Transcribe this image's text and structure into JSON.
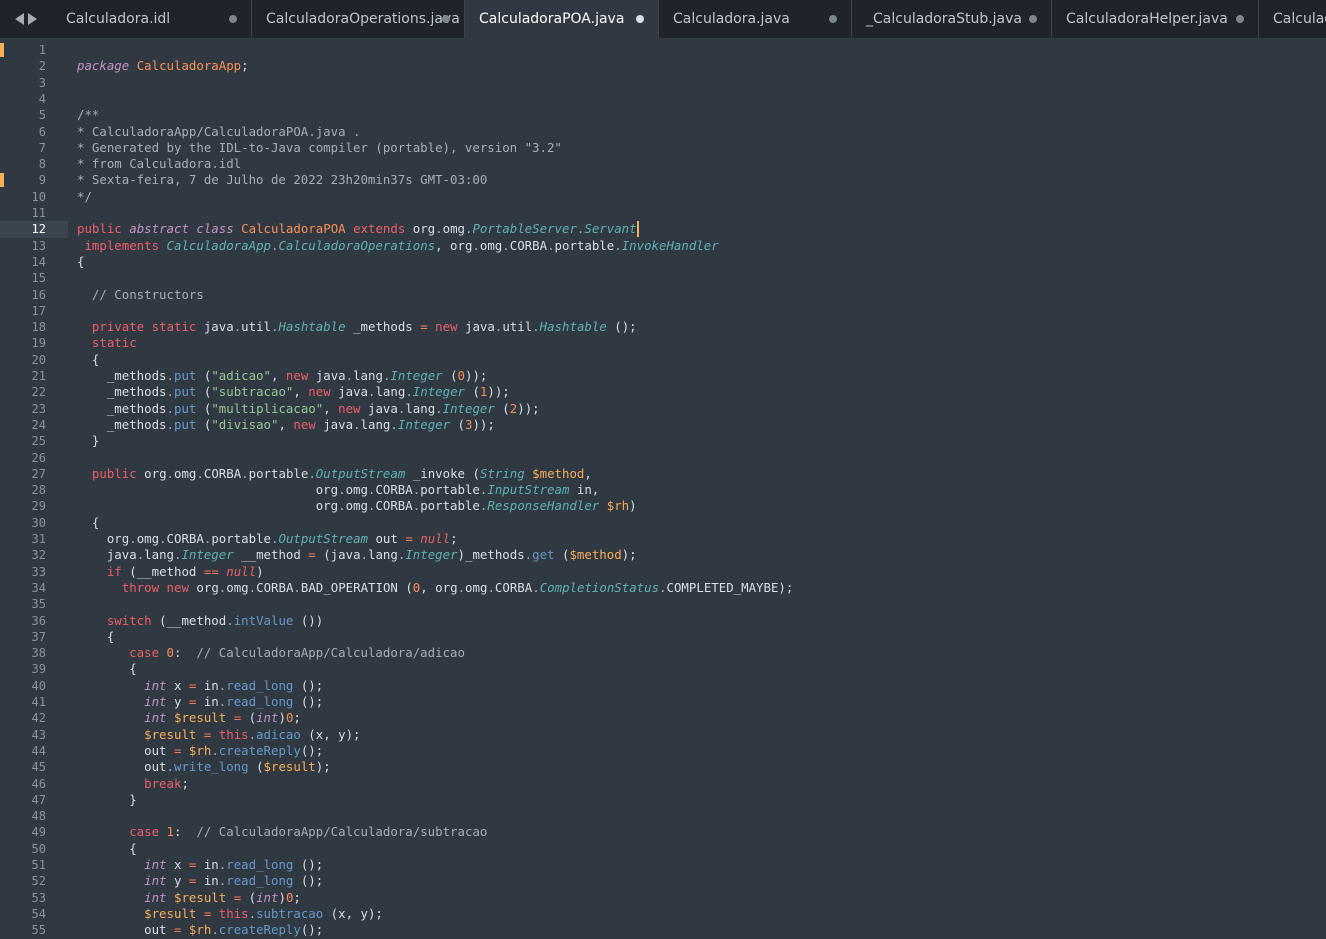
{
  "tabs": [
    {
      "label": "Calculadora.idl",
      "active": false,
      "dirty": true
    },
    {
      "label": "CalculadoraOperations.java",
      "active": false,
      "dirty": true
    },
    {
      "label": "CalculadoraPOA.java",
      "active": true,
      "dirty": true
    },
    {
      "label": "Calculadora.java",
      "active": false,
      "dirty": true
    },
    {
      "label": "_CalculadoraStub.java",
      "active": false,
      "dirty": true
    },
    {
      "label": "CalculadoraHelper.java",
      "active": false,
      "dirty": true
    },
    {
      "label": "Calculad",
      "active": false,
      "dirty": false
    }
  ],
  "editor": {
    "current_line": 12,
    "modified_lines": [
      1,
      9
    ],
    "lines": [
      "",
      "package CalculadoraApp;",
      "",
      "",
      "/**",
      "* CalculadoraApp/CalculadoraPOA.java .",
      "* Generated by the IDL-to-Java compiler (portable), version \"3.2\"",
      "* from Calculadora.idl",
      "* Sexta-feira, 7 de Julho de 2022 23h20min37s GMT-03:00",
      "*/",
      "",
      "public abstract class CalculadoraPOA extends org.omg.PortableServer.Servant",
      " implements CalculadoraApp.CalculadoraOperations, org.omg.CORBA.portable.InvokeHandler",
      "{",
      "",
      "  // Constructors",
      "",
      "  private static java.util.Hashtable _methods = new java.util.Hashtable ();",
      "  static",
      "  {",
      "    _methods.put (\"adicao\", new java.lang.Integer (0));",
      "    _methods.put (\"subtracao\", new java.lang.Integer (1));",
      "    _methods.put (\"multiplicacao\", new java.lang.Integer (2));",
      "    _methods.put (\"divisao\", new java.lang.Integer (3));",
      "  }",
      "",
      "  public org.omg.CORBA.portable.OutputStream _invoke (String $method,",
      "                                org.omg.CORBA.portable.InputStream in,",
      "                                org.omg.CORBA.portable.ResponseHandler $rh)",
      "  {",
      "    org.omg.CORBA.portable.OutputStream out = null;",
      "    java.lang.Integer __method = (java.lang.Integer)_methods.get ($method);",
      "    if (__method == null)",
      "      throw new org.omg.CORBA.BAD_OPERATION (0, org.omg.CORBA.CompletionStatus.COMPLETED_MAYBE);",
      "",
      "    switch (__method.intValue ())",
      "    {",
      "       case 0:  // CalculadoraApp/Calculadora/adicao",
      "       {",
      "         int x = in.read_long ();",
      "         int y = in.read_long ();",
      "         int $result = (int)0;",
      "         $result = this.adicao (x, y);",
      "         out = $rh.createReply();",
      "         out.write_long ($result);",
      "         break;",
      "       }",
      "",
      "       case 1:  // CalculadoraApp/Calculadora/subtracao",
      "       {",
      "         int x = in.read_long ();",
      "         int y = in.read_long ();",
      "         int $result = (int)0;",
      "         $result = this.subtracao (x, y);",
      "         out = $rh.createReply();"
    ]
  }
}
